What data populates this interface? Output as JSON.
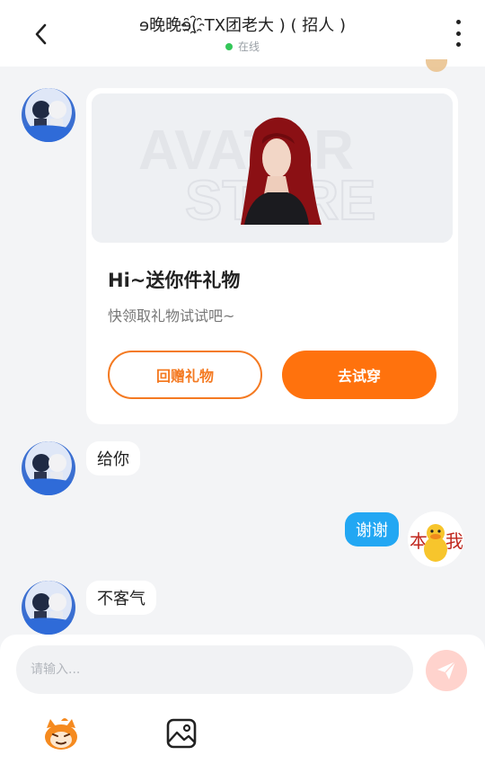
{
  "header": {
    "title": "ɘ晚晚ɘ(҈TX团老大 ) ( 招人 )",
    "status": "在线",
    "status_color": "#34c759"
  },
  "gift_card": {
    "banner_text_line1": "AVATAR",
    "banner_text_line2": "STORE",
    "title": "Hi~送你件礼物",
    "subtitle": "快领取礼物试试吧~",
    "return_gift_label": "回赠礼物",
    "try_on_label": "去试穿"
  },
  "messages": [
    {
      "from": "other",
      "text": "给你"
    },
    {
      "from": "self",
      "text": "谢谢"
    },
    {
      "from": "other",
      "text": "不客气"
    }
  ],
  "composer": {
    "placeholder": "请输入...",
    "value": ""
  },
  "icons": {
    "back": "chevron-left-icon",
    "more": "more-vertical-icon",
    "send": "send-icon",
    "emoji": "emoji-icon",
    "image": "image-icon"
  },
  "colors": {
    "accent": "#ff720d",
    "outgoing_bubble": "#22a7f3"
  }
}
